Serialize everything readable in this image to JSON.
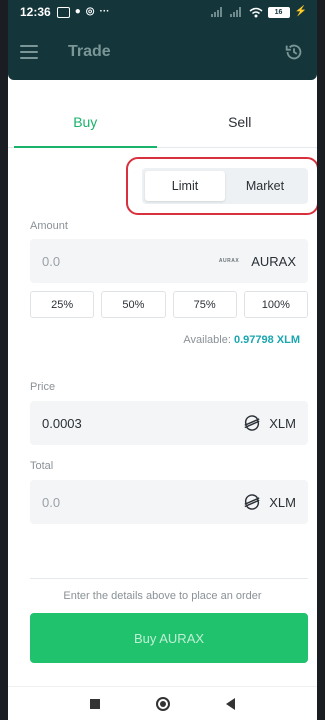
{
  "status_bar": {
    "time": "12:36",
    "more": "···",
    "battery": "16"
  },
  "app_bar": {
    "title": "Trade"
  },
  "tabs": [
    {
      "label": "Buy",
      "active": true
    },
    {
      "label": "Sell",
      "active": false
    }
  ],
  "order_type": {
    "options": [
      "Limit",
      "Market"
    ],
    "selected": "Limit"
  },
  "amount": {
    "label": "Amount",
    "value": "0.0",
    "asset_logo_text": "AURAX",
    "unit": "AURAX",
    "percent_buttons": [
      "25%",
      "50%",
      "75%",
      "100%"
    ]
  },
  "available": {
    "label": "Available:",
    "value": "0.97798 XLM"
  },
  "price": {
    "label": "Price",
    "value": "0.0003",
    "unit": "XLM",
    "icon": "stellar-icon"
  },
  "total": {
    "label": "Total",
    "value": "0.0",
    "unit": "XLM",
    "icon": "stellar-icon"
  },
  "hint": "Enter the details above to place an order",
  "buy_button": {
    "label": "Buy AURAX"
  },
  "colors": {
    "header": "#14353a",
    "accent_green": "#1ab36b",
    "button_green": "#20c26e",
    "available_teal": "#1aa6b0",
    "highlight_red": "#d8303c"
  }
}
